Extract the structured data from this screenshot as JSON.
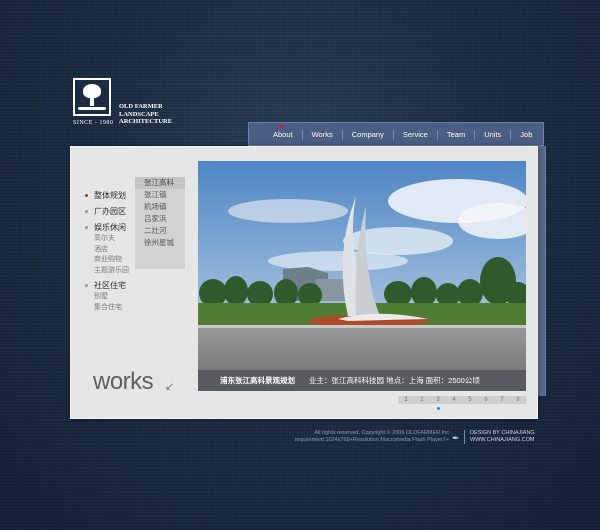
{
  "logo": {
    "since": "SINCE - 1980",
    "name": "OLD FARMER\nLANDSCAPE\nARCHITECTURE"
  },
  "nav": {
    "items": [
      "About",
      "Works",
      "Company",
      "Service",
      "Team",
      "Units",
      "Job"
    ]
  },
  "menu": {
    "categories": [
      {
        "label": "整体规划",
        "active": true,
        "subs": []
      },
      {
        "label": "厂办园区",
        "active": false,
        "subs": []
      },
      {
        "label": "娱乐休闲",
        "active": false,
        "subs": [
          "高尔夫",
          "酒店",
          "商业购物",
          "主题游乐园"
        ]
      },
      {
        "label": "社区住宅",
        "active": false,
        "subs": [
          "别墅",
          "集合住宅"
        ]
      }
    ],
    "projects": [
      "张江高科",
      "张江镇",
      "机场镇",
      "吕家浜",
      "二灶河",
      "徐州星城"
    ]
  },
  "works_label": "works",
  "caption": {
    "title": "浦东张江高科景观规划",
    "info": "业主：张江高科科技园    地点：上海    面积：2500公顷"
  },
  "pager": [
    "1",
    "2",
    "3",
    "4",
    "5",
    "6",
    "7",
    "8"
  ],
  "footer": {
    "line1": "All rights reserved.  Copyright © 2006 OLDFARMER.Inc",
    "line2": "requirement:1024x768+Resolution.Macromedia Flash Player7+",
    "design": "DESIGN BY CHINAJIANG",
    "site": "WWW.CHINAJIANG.COM"
  },
  "colors": {
    "accent": "#d02020",
    "nav_bg": "#4a5d82",
    "page_bg": "#1e2d40"
  }
}
